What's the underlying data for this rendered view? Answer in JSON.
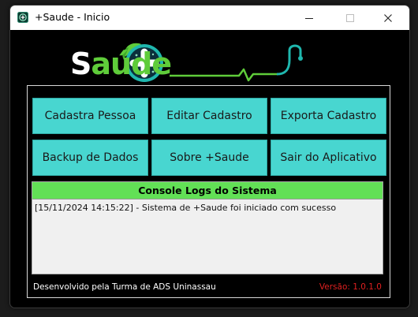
{
  "window": {
    "title": "+Saude - Inicio",
    "controls": [
      "minimize-icon",
      "maximize-icon",
      "close-icon"
    ]
  },
  "logo": {
    "wordmark": "Saúde",
    "colors": {
      "white": "#ffffff",
      "green": "#5fcc3a",
      "teal": "#1fb7ae"
    }
  },
  "buttons": [
    {
      "label": "Cadastra Pessoa"
    },
    {
      "label": "Editar Cadastro"
    },
    {
      "label": "Exporta Cadastro"
    },
    {
      "label": "Backup de Dados"
    },
    {
      "label": "Sobre +Saude"
    },
    {
      "label": "Sair do Aplicativo"
    }
  ],
  "console": {
    "title": "Console Logs do Sistema",
    "lines": [
      "[15/11/2024 14:15:22] - Sistema de +Saude foi iniciado com sucesso"
    ]
  },
  "footer": {
    "credit": "Desenvolvido pela Turma de ADS Uninassau",
    "version": "Versão: 1.0.1.0"
  },
  "colors": {
    "button_bg": "#48d6d0",
    "console_header_bg": "#62e056",
    "version_text": "#e02020"
  }
}
